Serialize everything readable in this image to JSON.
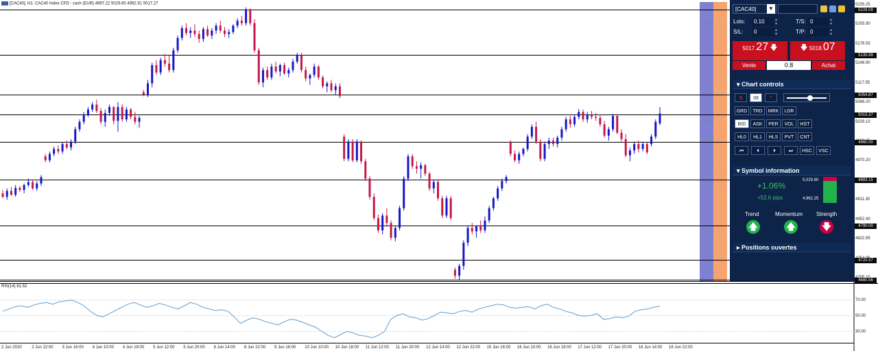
{
  "chart_header": "[CAC40], H1:  CAC40 Index CFD - cash (EUR)  4997.22 5029.60 4992.91 5017.27",
  "rsi_label": "RSI(14) 61.52",
  "price_axis_labels": [
    "5235.25",
    "5205.90",
    "5176.55",
    "5146.90",
    "5117.55",
    "5088.20",
    "5029.10",
    "4999.65",
    "4970.20",
    "4940.75",
    "4911.30",
    "4852.40",
    "4822.95",
    "4764.05",
    "4705.15"
  ],
  "level_tags": [
    "5228.09",
    "5135.99",
    "5054.87",
    "5015.37",
    "4960.00",
    "4883.15",
    "4790.00",
    "4720.57",
    "4680.56"
  ],
  "rsi_axis_labels": [
    "70.00",
    "50.00",
    "30.00"
  ],
  "time_labels": [
    "2 Jun 2020",
    "2 Jun 22:00",
    "3 Jun 16:00",
    "4 Jun 10:00",
    "4 Jun 18:00",
    "5 Jun 12:00",
    "5 Jun 20:00",
    "8 Jun 14:00",
    "8 Jun 22:00",
    "9 Jun 16:00",
    "10 Jun 10:00",
    "10 Jun 18:00",
    "11 Jun 12:00",
    "11 Jun 20:00",
    "12 Jun 14:00",
    "12 Jun 22:00",
    "15 Jun 16:00",
    "16 Jun 10:00",
    "16 Jun 18:00",
    "17 Jun 12:00",
    "17 Jun 20:00",
    "18 Jun 14:00",
    "18 Jun 22:00"
  ],
  "panel": {
    "symbol": "[CAC40]",
    "lots_label": "Lots:",
    "lots_value": "0.10",
    "sl_label": "S/L:",
    "sl_value": "0",
    "ts_label": "T/S:",
    "ts_value": "0",
    "tp_label": "T/P:",
    "tp_value": "0",
    "sell_small": "5017.",
    "sell_big": "27",
    "sell_label": "Vente",
    "buy_small": "5018.",
    "buy_big": "07",
    "buy_label": "Achat",
    "spread": "0.8",
    "chart_controls_title": "Chart controls",
    "chart_controls_value": "08",
    "row1": [
      "GRD",
      "TRD",
      "MRK",
      "LDR"
    ],
    "row2": [
      "BID",
      "ASK",
      "PER",
      "VOL",
      "HST"
    ],
    "row3": [
      "HL0",
      "HL1",
      "HLS",
      "PVT",
      "CNT"
    ],
    "row4_extra": [
      "HSC",
      "VSC"
    ],
    "symbol_info_title": "Symbol information",
    "change_pct": "+1.06%",
    "change_pips": "+52.6 pips",
    "high_value": "5,029.60",
    "low_value": "4,962.25",
    "trend_label": "Trend",
    "momentum_label": "Momentum",
    "strength_label": "Strength",
    "positions_title": "Positions ouvertes"
  },
  "colors": {
    "bull": "#1616c8",
    "bear": "#c3184a",
    "panel_bg": "#0d2348",
    "sell": "#c8101e",
    "up_green": "#21b24a",
    "down_red": "#c8004a",
    "band_purple": "#7b7bd0",
    "band_orange": "#f4a06a",
    "rsi_line": "#5e9ccf"
  },
  "chart_data": {
    "type": "candlestick",
    "ylim": [
      4680,
      5240
    ],
    "horizontal_levels": [
      5228.09,
      5135.99,
      5054.87,
      5015.37,
      4960.0,
      4883.15,
      4790.0,
      4720.57,
      4680.56
    ],
    "candles": [
      [
        4855,
        4862,
        4845,
        4848
      ],
      [
        4848,
        4865,
        4842,
        4860
      ],
      [
        4860,
        4868,
        4850,
        4852
      ],
      [
        4852,
        4872,
        4848,
        4866
      ],
      [
        4866,
        4870,
        4858,
        4862
      ],
      [
        4862,
        4875,
        4855,
        4872
      ],
      [
        4872,
        4885,
        4868,
        4878
      ],
      [
        4878,
        4882,
        4862,
        4865
      ],
      [
        4865,
        4880,
        4860,
        4875
      ],
      [
        4875,
        4892,
        4870,
        4888
      ],
      [
        4930,
        4935,
        4918,
        4922
      ],
      [
        4922,
        4940,
        4918,
        4935
      ],
      [
        4935,
        4950,
        4930,
        4945
      ],
      [
        4945,
        4952,
        4935,
        4940
      ],
      [
        4940,
        4958,
        4935,
        4955
      ],
      [
        4955,
        4962,
        4944,
        4948
      ],
      [
        4948,
        4965,
        4942,
        4960
      ],
      [
        4960,
        4990,
        4955,
        4985
      ],
      [
        4985,
        5005,
        4980,
        5000
      ],
      [
        5000,
        5020,
        4995,
        5015
      ],
      [
        5015,
        5030,
        5010,
        5025
      ],
      [
        5025,
        5040,
        5020,
        5035
      ],
      [
        5035,
        5045,
        5018,
        5022
      ],
      [
        5022,
        5028,
        4995,
        5000
      ],
      [
        5000,
        5025,
        4990,
        5018
      ],
      [
        5018,
        5035,
        5012,
        5030
      ],
      [
        5030,
        5032,
        4995,
        5002
      ],
      [
        5002,
        5040,
        4980,
        5030
      ],
      [
        5030,
        5036,
        5000,
        5005
      ],
      [
        5005,
        5030,
        5000,
        5025
      ],
      [
        5025,
        5028,
        5005,
        5010
      ],
      [
        5010,
        5020,
        4995,
        5000
      ],
      [
        5000,
        5012,
        4988,
        5008
      ],
      [
        5060,
        5065,
        5052,
        5055
      ],
      [
        5055,
        5085,
        5050,
        5078
      ],
      [
        5078,
        5120,
        5070,
        5115
      ],
      [
        5115,
        5125,
        5095,
        5100
      ],
      [
        5100,
        5130,
        5095,
        5125
      ],
      [
        5125,
        5138,
        5112,
        5118
      ],
      [
        5118,
        5135,
        5100,
        5105
      ],
      [
        5105,
        5150,
        5100,
        5145
      ],
      [
        5145,
        5175,
        5140,
        5170
      ],
      [
        5170,
        5195,
        5165,
        5190
      ],
      [
        5190,
        5200,
        5175,
        5180
      ],
      [
        5180,
        5192,
        5170,
        5185
      ],
      [
        5185,
        5198,
        5172,
        5178
      ],
      [
        5178,
        5185,
        5160,
        5168
      ],
      [
        5168,
        5192,
        5162,
        5188
      ],
      [
        5188,
        5195,
        5172,
        5175
      ],
      [
        5175,
        5190,
        5168,
        5185
      ],
      [
        5185,
        5200,
        5178,
        5195
      ],
      [
        5195,
        5205,
        5180,
        5185
      ],
      [
        5185,
        5192,
        5172,
        5178
      ],
      [
        5178,
        5188,
        5170,
        5182
      ],
      [
        5182,
        5198,
        5178,
        5195
      ],
      [
        5195,
        5210,
        5190,
        5205
      ],
      [
        5205,
        5215,
        5195,
        5200
      ],
      [
        5200,
        5232,
        5195,
        5228
      ],
      [
        5228,
        5230,
        5195,
        5200
      ],
      [
        5200,
        5208,
        5140,
        5145
      ],
      [
        5145,
        5150,
        5075,
        5080
      ],
      [
        5080,
        5110,
        5070,
        5105
      ],
      [
        5105,
        5112,
        5085,
        5090
      ],
      [
        5090,
        5118,
        5085,
        5112
      ],
      [
        5112,
        5122,
        5098,
        5102
      ],
      [
        5102,
        5118,
        5092,
        5115
      ],
      [
        5115,
        5120,
        5095,
        5098
      ],
      [
        5098,
        5110,
        5090,
        5105
      ],
      [
        5105,
        5128,
        5100,
        5122
      ],
      [
        5122,
        5140,
        5118,
        5135
      ],
      [
        5135,
        5140,
        5100,
        5105
      ],
      [
        5105,
        5112,
        5082,
        5088
      ],
      [
        5088,
        5098,
        5075,
        5095
      ],
      [
        5095,
        5118,
        5090,
        5112
      ],
      [
        5112,
        5115,
        5085,
        5090
      ],
      [
        5090,
        5094,
        5068,
        5072
      ],
      [
        5072,
        5082,
        5060,
        5078
      ],
      [
        5078,
        5085,
        5060,
        5064
      ],
      [
        5064,
        5078,
        5055,
        5072
      ],
      [
        5072,
        5078,
        5048,
        5052
      ],
      [
        4970,
        4975,
        4920,
        4925
      ],
      [
        4925,
        4965,
        4920,
        4960
      ],
      [
        4960,
        4965,
        4918,
        4922
      ],
      [
        4922,
        4965,
        4918,
        4960
      ],
      [
        4960,
        4962,
        4915,
        4920
      ],
      [
        4920,
        4925,
        4880,
        4885
      ],
      [
        4885,
        4890,
        4842,
        4848
      ],
      [
        4848,
        4855,
        4800,
        4805
      ],
      [
        4805,
        4812,
        4775,
        4780
      ],
      [
        4780,
        4815,
        4772,
        4810
      ],
      [
        4810,
        4825,
        4790,
        4795
      ],
      [
        4795,
        4800,
        4760,
        4765
      ],
      [
        4765,
        4790,
        4758,
        4785
      ],
      [
        4785,
        4830,
        4780,
        4825
      ],
      [
        4825,
        4890,
        4820,
        4885
      ],
      [
        4885,
        4935,
        4880,
        4930
      ],
      [
        4930,
        4935,
        4905,
        4910
      ],
      [
        4910,
        4920,
        4895,
        4905
      ],
      [
        4905,
        4918,
        4885,
        4912
      ],
      [
        4912,
        4915,
        4890,
        4895
      ],
      [
        4895,
        4898,
        4860,
        4865
      ],
      [
        4865,
        4882,
        4855,
        4878
      ],
      [
        4878,
        4882,
        4840,
        4845
      ],
      [
        4845,
        4850,
        4805,
        4810
      ],
      [
        4810,
        4850,
        4805,
        4845
      ],
      [
        4845,
        4850,
        4800,
        4805
      ],
      [
        4700,
        4705,
        4682,
        4688
      ],
      [
        4688,
        4712,
        4680,
        4708
      ],
      [
        4708,
        4760,
        4700,
        4755
      ],
      [
        4755,
        4790,
        4748,
        4785
      ],
      [
        4785,
        4795,
        4772,
        4778
      ],
      [
        4778,
        4790,
        4765,
        4788
      ],
      [
        4788,
        4800,
        4775,
        4780
      ],
      [
        4780,
        4808,
        4775,
        4800
      ],
      [
        4800,
        4830,
        4795,
        4825
      ],
      [
        4825,
        4848,
        4820,
        4845
      ],
      [
        4845,
        4870,
        4840,
        4865
      ],
      [
        4865,
        4885,
        4860,
        4880
      ],
      [
        4880,
        4892,
        4875,
        4888
      ],
      [
        4960,
        4962,
        4930,
        4935
      ],
      [
        4935,
        4942,
        4918,
        4922
      ],
      [
        4922,
        4940,
        4915,
        4935
      ],
      [
        4935,
        4948,
        4930,
        4945
      ],
      [
        4945,
        4975,
        4940,
        4970
      ],
      [
        4970,
        4995,
        4965,
        4990
      ],
      [
        4990,
        5000,
        4955,
        4960
      ],
      [
        4960,
        4965,
        4920,
        4925
      ],
      [
        4925,
        4960,
        4920,
        4955
      ],
      [
        4955,
        4968,
        4945,
        4962
      ],
      [
        4962,
        4968,
        4950,
        4955
      ],
      [
        4955,
        4972,
        4948,
        4968
      ],
      [
        4968,
        4990,
        4962,
        4985
      ],
      [
        4985,
        5010,
        4980,
        5005
      ],
      [
        5005,
        5012,
        4988,
        4995
      ],
      [
        4995,
        5015,
        4990,
        5010
      ],
      [
        5010,
        5026,
        5005,
        5020
      ],
      [
        5020,
        5025,
        5000,
        5005
      ],
      [
        5005,
        5020,
        4998,
        5015
      ],
      [
        5015,
        5022,
        5005,
        5010
      ],
      [
        5010,
        5018,
        5002,
        5008
      ],
      [
        5008,
        5015,
        4990,
        4995
      ],
      [
        4995,
        5002,
        4968,
        4972
      ],
      [
        4972,
        4990,
        4962,
        4985
      ],
      [
        4985,
        5016,
        4980,
        5012
      ],
      [
        5012,
        5015,
        4975,
        4978
      ],
      [
        4978,
        4985,
        4960,
        4965
      ],
      [
        4965,
        4975,
        4928,
        4932
      ],
      [
        4932,
        4948,
        4920,
        4942
      ],
      [
        4942,
        4960,
        4935,
        4955
      ],
      [
        4955,
        4962,
        4938,
        4945
      ],
      [
        4945,
        4960,
        4940,
        4955
      ],
      [
        4955,
        4958,
        4935,
        4938
      ],
      [
        4955,
        4975,
        4950,
        4970
      ],
      [
        4970,
        5005,
        4965,
        5000
      ],
      [
        4997,
        5030,
        4993,
        5017
      ]
    ],
    "rsi": [
      55,
      58,
      61,
      62,
      60,
      63,
      65,
      66,
      64,
      67,
      68,
      69,
      66,
      62,
      55,
      50,
      48,
      52,
      56,
      60,
      64,
      66,
      63,
      60,
      62,
      65,
      63,
      60,
      58,
      62,
      66,
      64,
      60,
      58,
      56,
      57,
      55,
      48,
      40,
      44,
      47,
      45,
      42,
      40,
      38,
      42,
      45,
      44,
      41,
      38,
      35,
      30,
      25,
      22,
      26,
      30,
      28,
      25,
      24,
      22,
      25,
      30,
      45,
      50,
      52,
      48,
      47,
      44,
      46,
      50,
      54,
      53,
      52,
      55,
      56,
      54,
      58,
      60,
      62,
      64,
      63,
      60,
      59,
      60,
      61,
      58,
      62,
      64,
      60,
      58,
      55,
      53,
      50,
      49,
      50,
      52,
      45,
      46,
      48,
      47,
      49,
      55,
      57,
      58,
      60,
      61.52
    ],
    "rsi_ylim": [
      20,
      80
    ],
    "rsi_levels": [
      70,
      50,
      30
    ]
  }
}
